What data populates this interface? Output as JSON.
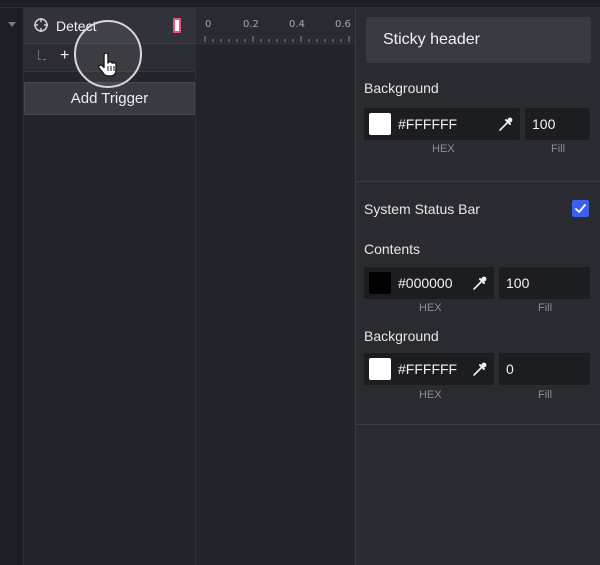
{
  "layers": {
    "detect_label": "Detect",
    "add_symbol": "+",
    "add_trigger_label": "Add Trigger"
  },
  "timeline": {
    "ticks": [
      "0",
      "0.2",
      "0.4",
      "0.6"
    ]
  },
  "inspector": {
    "title": "Sticky header",
    "background": {
      "label": "Background",
      "hex": "#FFFFFF",
      "fill": "100",
      "hex_caption": "HEX",
      "fill_caption": "Fill"
    },
    "status_bar": {
      "label": "System Status Bar",
      "checked": true
    },
    "contents": {
      "label": "Contents",
      "hex": "#000000",
      "fill": "100",
      "hex_caption": "HEX",
      "fill_caption": "Fill"
    },
    "status_background": {
      "label": "Background",
      "hex": "#FFFFFF",
      "fill": "0",
      "hex_caption": "HEX",
      "fill_caption": "Fill"
    }
  },
  "colors": {
    "accent": "#3d5ff0",
    "marker": "#e8537b",
    "white": "#FFFFFF",
    "black": "#000000"
  },
  "icons": {
    "expand": "caret-down-icon",
    "target": "target-icon",
    "cursor": "hand-pointer-icon",
    "dropper": "eyedropper-icon",
    "check": "checkmark-icon"
  }
}
